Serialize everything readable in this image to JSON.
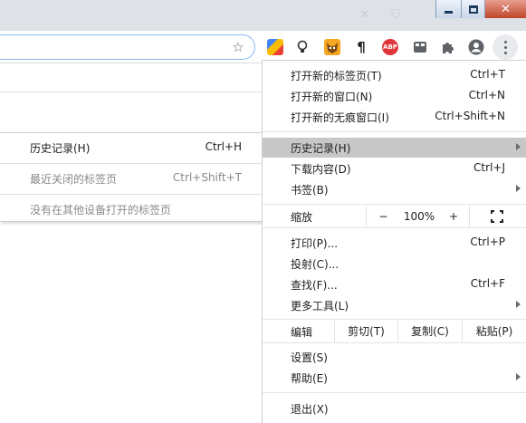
{
  "window": {
    "minimize_icon": "minimize-icon",
    "maximize_icon": "restore-icon",
    "close_icon": "close-icon"
  },
  "toolbar": {
    "bookmark_icon": "star-icon",
    "extensions": [
      "colorful-extension-icon",
      "bulb-extension-icon",
      "fox-extension-icon",
      "pilcrow-extension-icon",
      "adblock-plus-icon",
      "tab-extension-icon",
      "puzzle-extensions-icon",
      "profile-avatar-icon"
    ],
    "abp_text": "ABP",
    "menu_icon": "three-dots-icon"
  },
  "history_submenu": {
    "items": [
      {
        "label": "历史记录(H)",
        "shortcut": "Ctrl+H"
      },
      {
        "label": "最近关闭的标签页",
        "shortcut": "Ctrl+Shift+T"
      },
      {
        "label": "没有在其他设备打开的标签页",
        "shortcut": ""
      }
    ]
  },
  "menu": {
    "new_tab": {
      "label": "打开新的标签页(T)",
      "shortcut": "Ctrl+T"
    },
    "new_window": {
      "label": "打开新的窗口(N)",
      "shortcut": "Ctrl+N"
    },
    "new_incognito": {
      "label": "打开新的无痕窗口(I)",
      "shortcut": "Ctrl+Shift+N"
    },
    "history": {
      "label": "历史记录(H)"
    },
    "downloads": {
      "label": "下载内容(D)",
      "shortcut": "Ctrl+J"
    },
    "bookmarks": {
      "label": "书签(B)"
    },
    "zoom": {
      "label": "缩放",
      "minus": "−",
      "value": "100%",
      "plus": "+"
    },
    "print": {
      "label": "打印(P)...",
      "shortcut": "Ctrl+P"
    },
    "cast": {
      "label": "投射(C)..."
    },
    "find": {
      "label": "查找(F)...",
      "shortcut": "Ctrl+F"
    },
    "more_tools": {
      "label": "更多工具(L)"
    },
    "edit": {
      "label": "编辑",
      "cut": "剪切(T)",
      "copy": "复制(C)",
      "paste": "粘贴(P)"
    },
    "settings": {
      "label": "设置(S)"
    },
    "help": {
      "label": "帮助(E)"
    },
    "exit": {
      "label": "退出(X)"
    }
  },
  "colors": {
    "highlight": "#c7c7c7",
    "accent": "#8ab4f8",
    "abp_red": "#e0363b"
  }
}
